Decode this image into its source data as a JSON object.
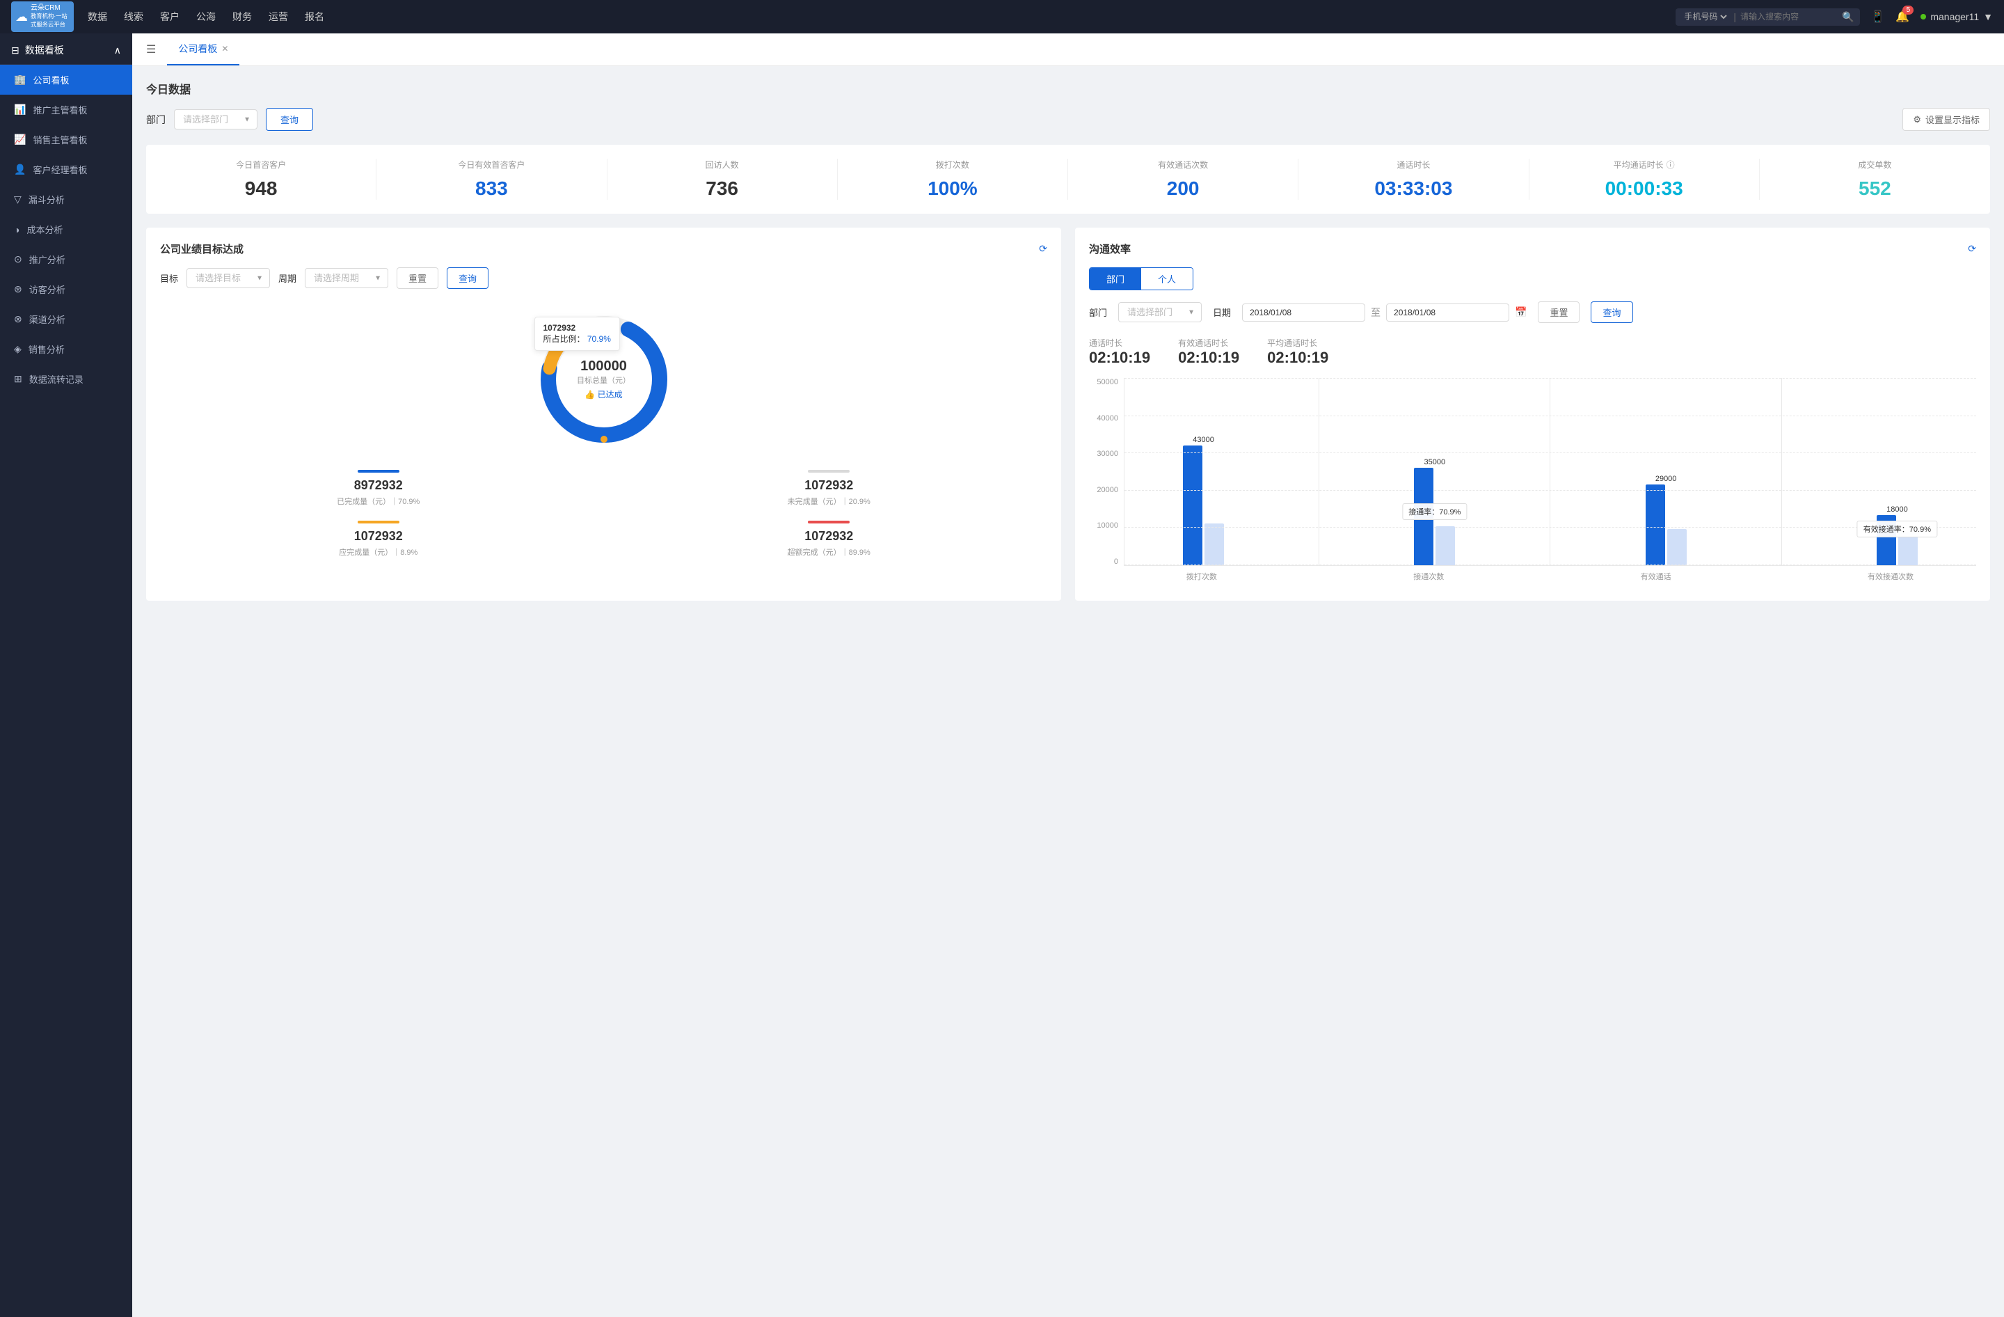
{
  "app": {
    "logo_text": "云朵CRM",
    "logo_sub": "教育机构一站\n代服务云平台"
  },
  "top_nav": {
    "links": [
      "数据",
      "线索",
      "客户",
      "公海",
      "财务",
      "运营",
      "报名"
    ],
    "search_placeholder": "请输入搜索内容",
    "search_type": "手机号码",
    "badge_count": "5",
    "username": "manager11"
  },
  "sidebar": {
    "section": "数据看板",
    "items": [
      {
        "label": "公司看板",
        "icon": "🏢",
        "active": true
      },
      {
        "label": "推广主管看板",
        "icon": "📊",
        "active": false
      },
      {
        "label": "销售主管看板",
        "icon": "📈",
        "active": false
      },
      {
        "label": "客户经理看板",
        "icon": "👤",
        "active": false
      },
      {
        "label": "漏斗分析",
        "icon": "▽",
        "active": false
      },
      {
        "label": "成本分析",
        "icon": "◑",
        "active": false
      },
      {
        "label": "推广分析",
        "icon": "⊙",
        "active": false
      },
      {
        "label": "访客分析",
        "icon": "⊛",
        "active": false
      },
      {
        "label": "渠道分析",
        "icon": "⊗",
        "active": false
      },
      {
        "label": "销售分析",
        "icon": "◈",
        "active": false
      },
      {
        "label": "数据流转记录",
        "icon": "⊞",
        "active": false
      }
    ]
  },
  "tab_bar": {
    "tabs": [
      {
        "label": "公司看板",
        "active": true,
        "closable": true
      }
    ]
  },
  "today_data": {
    "title": "今日数据",
    "filter_label": "部门",
    "filter_placeholder": "请选择部门",
    "query_btn": "查询",
    "settings_btn": "设置显示指标",
    "stats": [
      {
        "label": "今日首咨客户",
        "value": "948",
        "color": "black"
      },
      {
        "label": "今日有效首咨客户",
        "value": "833",
        "color": "black"
      },
      {
        "label": "回访人数",
        "value": "736",
        "color": "black"
      },
      {
        "label": "拨打次数",
        "value": "100%",
        "color": "dark-blue"
      },
      {
        "label": "有效通话次数",
        "value": "200",
        "color": "dark-blue"
      },
      {
        "label": "通话时长",
        "value": "03:33:03",
        "color": "dark-blue"
      },
      {
        "label": "平均通话时长",
        "value": "00:00:33",
        "color": "cyan"
      },
      {
        "label": "成交单数",
        "value": "552",
        "color": "teal"
      }
    ]
  },
  "target_card": {
    "title": "公司业绩目标达成",
    "target_label": "目标",
    "target_placeholder": "请选择目标",
    "period_label": "周期",
    "period_placeholder": "请选择周期",
    "reset_btn": "重置",
    "query_btn": "查询",
    "donut": {
      "total": "100000",
      "total_label": "目标总量（元）",
      "achieved_label": "👍 已达成",
      "tooltip_value": "1072932",
      "tooltip_pct": "70.9%",
      "tooltip_label": "所占比例：",
      "blue_pct": 70.9,
      "orange_pct": 20
    },
    "mini_stats": [
      {
        "bar_color": "blue",
        "value": "8972932",
        "desc": "已完成量（元）｜70.9%"
      },
      {
        "bar_color": "gray",
        "value": "1072932",
        "desc": "未完成量（元）｜20.9%"
      },
      {
        "bar_color": "orange",
        "value": "1072932",
        "desc": "应完成量（元）｜8.9%"
      },
      {
        "bar_color": "red",
        "value": "1072932",
        "desc": "超额完成（元）｜89.9%"
      }
    ]
  },
  "efficiency_card": {
    "title": "沟通效率",
    "tab_dept": "部门",
    "tab_personal": "个人",
    "dept_label": "部门",
    "dept_placeholder": "请选择部门",
    "date_label": "日期",
    "date_from": "2018/01/08",
    "date_to": "2018/01/08",
    "reset_btn": "重置",
    "query_btn": "查询",
    "stats": [
      {
        "label": "通话时长",
        "value": "02:10:19"
      },
      {
        "label": "有效通话时长",
        "value": "02:10:19"
      },
      {
        "label": "平均通话时长",
        "value": "02:10:19"
      }
    ],
    "chart": {
      "y_labels": [
        "50000",
        "40000",
        "30000",
        "20000",
        "10000",
        "0"
      ],
      "groups": [
        {
          "x_label": "拨打次数",
          "bars": [
            {
              "value": 43000,
              "label": "43000",
              "color": "blue"
            },
            {
              "value": 15000,
              "label": "",
              "color": "light"
            }
          ]
        },
        {
          "x_label": "接通次数",
          "bars": [
            {
              "value": 35000,
              "label": "35000",
              "color": "blue"
            },
            {
              "value": 14000,
              "label": "",
              "color": "light"
            }
          ],
          "pct_label": "接通率：70.9%",
          "pct_pos": "middle"
        },
        {
          "x_label": "有效通话",
          "bars": [
            {
              "value": 29000,
              "label": "29000",
              "color": "blue"
            },
            {
              "value": 13000,
              "label": "",
              "color": "light"
            }
          ]
        },
        {
          "x_label": "有效接通次数",
          "bars": [
            {
              "value": 18000,
              "label": "18000",
              "color": "blue"
            },
            {
              "value": 12000,
              "label": "",
              "color": "light"
            }
          ],
          "pct_label": "有效接通率：70.9%",
          "pct_pos": "right"
        }
      ]
    }
  }
}
